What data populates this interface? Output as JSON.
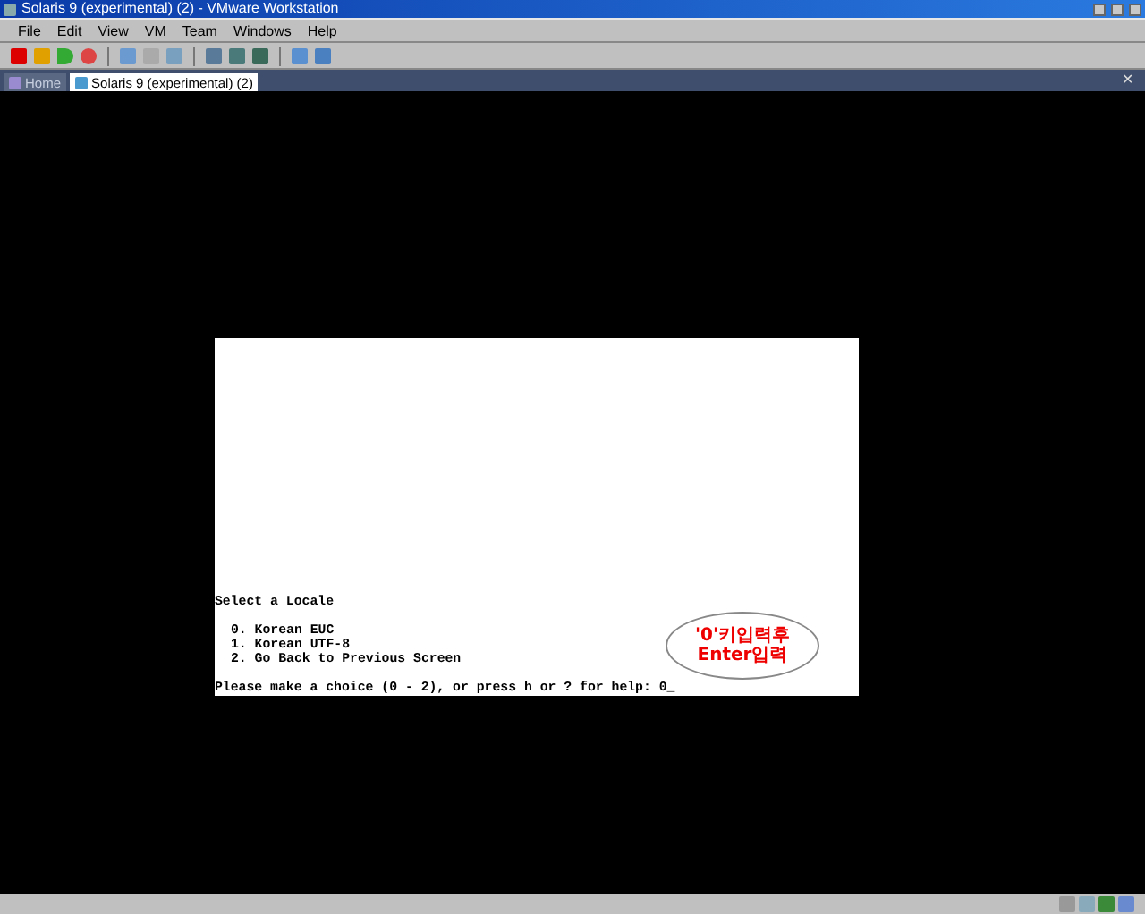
{
  "window": {
    "title": "Solaris 9 (experimental) (2) - VMware Workstation"
  },
  "menu": [
    "File",
    "Edit",
    "View",
    "VM",
    "Team",
    "Windows",
    "Help"
  ],
  "tabs": [
    {
      "label": "Home",
      "kind": "home",
      "selected": false
    },
    {
      "label": "Solaris 9 (experimental) (2)",
      "kind": "vm",
      "selected": true
    }
  ],
  "tab_close": "✕",
  "console": {
    "heading": "Select a Locale",
    "options": [
      "0. Korean EUC",
      "1. Korean UTF-8",
      "2. Go Back to Previous Screen"
    ],
    "prompt": "Please make a choice (0 - 2), or press h or ? for help: 0_"
  },
  "callout": {
    "lines": [
      "'0'키입력후",
      "Enter입력"
    ]
  }
}
